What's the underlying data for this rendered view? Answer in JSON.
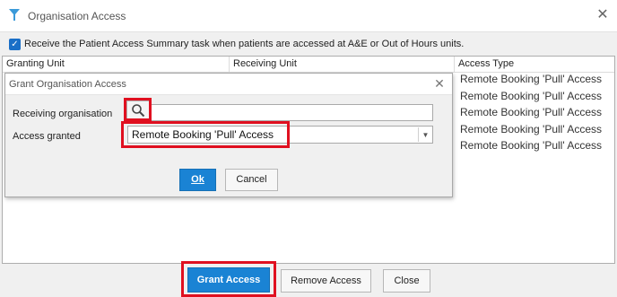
{
  "window": {
    "title": "Organisation Access",
    "close_icon": "close-icon"
  },
  "notify_checkbox": {
    "checked": true,
    "label": "Receive the Patient Access Summary task when patients are accessed at A&E or Out of Hours units."
  },
  "grid": {
    "columns": [
      "Granting Unit",
      "Receiving Unit",
      "Access Type"
    ],
    "access_types": [
      "Remote Booking 'Pull' Access",
      "Remote Booking 'Pull' Access",
      "Remote Booking 'Pull' Access",
      "Remote Booking 'Pull' Access",
      "Remote Booking 'Pull' Access"
    ]
  },
  "dialog": {
    "title": "Grant Organisation Access",
    "receiving_label": "Receiving organisation",
    "receiving_value": "",
    "access_label": "Access granted",
    "access_value": "Remote Booking 'Pull' Access",
    "ok_label": "Ok",
    "cancel_label": "Cancel"
  },
  "buttons": {
    "grant_label": "Grant Access",
    "remove_label": "Remove Access",
    "close_label": "Close"
  },
  "colors": {
    "accent": "#1a83d4",
    "highlight": "#e01020"
  }
}
